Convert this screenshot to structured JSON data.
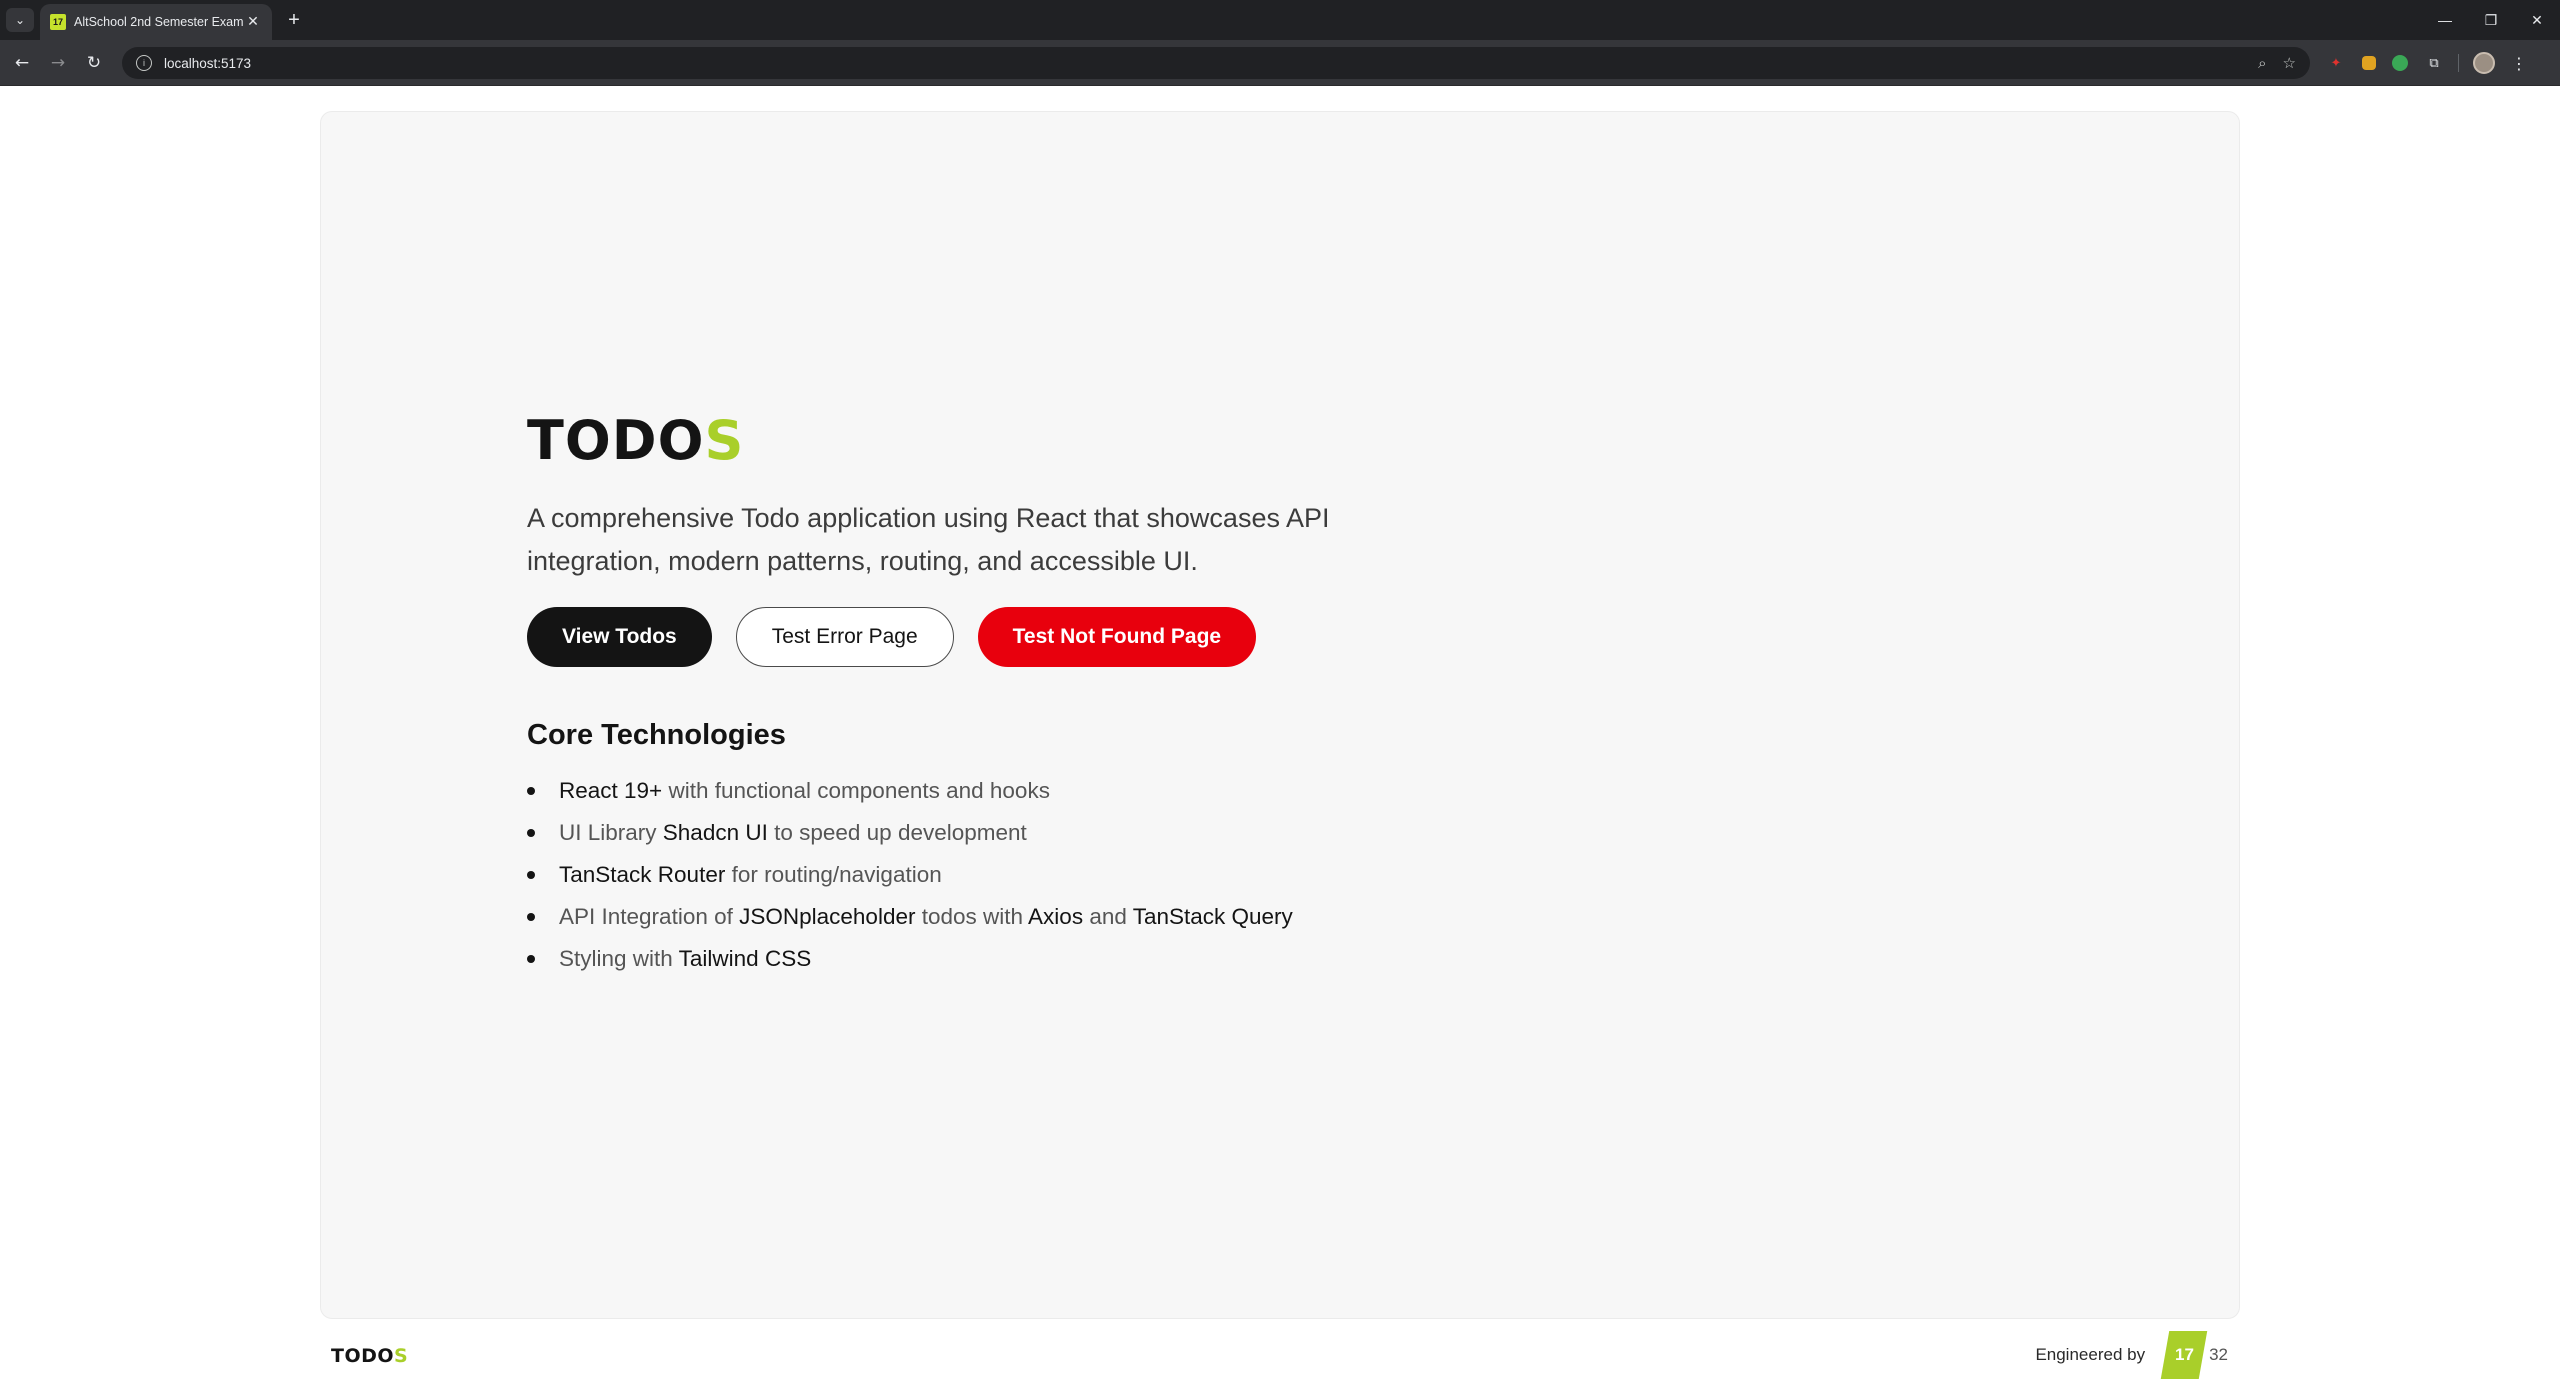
{
  "browser": {
    "tab_title": "AltSchool 2nd Semester Exam",
    "tab_favicon_text": "17",
    "url": "localhost:5173",
    "tab_close": "✕",
    "new_tab": "+",
    "window_minimize": "—",
    "window_restore": "❐",
    "window_close": "✕"
  },
  "hero": {
    "logo_main": "TODO",
    "logo_accent": "S",
    "description": "A comprehensive Todo application using React that showcases API integration, modern patterns, routing, and accessible UI.",
    "buttons": {
      "view_todos": "View Todos",
      "test_error": "Test Error Page",
      "test_not_found": "Test Not Found Page"
    }
  },
  "core": {
    "title": "Core Technologies",
    "items": [
      {
        "parts": [
          {
            "t": "React 19+",
            "hl": true
          },
          {
            "t": " with functional components and hooks",
            "hl": false
          }
        ]
      },
      {
        "parts": [
          {
            "t": "UI Library ",
            "hl": false
          },
          {
            "t": "Shadcn UI",
            "hl": true
          },
          {
            "t": " to speed up development",
            "hl": false
          }
        ]
      },
      {
        "parts": [
          {
            "t": "TanStack Router",
            "hl": true
          },
          {
            "t": " for routing/navigation",
            "hl": false
          }
        ]
      },
      {
        "parts": [
          {
            "t": "API Integration of ",
            "hl": false
          },
          {
            "t": "JSONplaceholder",
            "hl": true
          },
          {
            "t": " todos with ",
            "hl": false
          },
          {
            "t": "Axios",
            "hl": true
          },
          {
            "t": " and ",
            "hl": false
          },
          {
            "t": "TanStack Query",
            "hl": true
          }
        ]
      },
      {
        "parts": [
          {
            "t": "Styling with ",
            "hl": false
          },
          {
            "t": "Tailwind CSS",
            "hl": true
          }
        ]
      }
    ]
  },
  "footer": {
    "logo_main": "TODO",
    "logo_accent": "S",
    "engineered_by": "Engineered by",
    "badge": "17",
    "badge_suffix": "32"
  },
  "colors": {
    "accent": "#a9cf2a",
    "primary_button": "#141414",
    "danger_button": "#e8000d",
    "card_bg": "#f7f7f7"
  }
}
